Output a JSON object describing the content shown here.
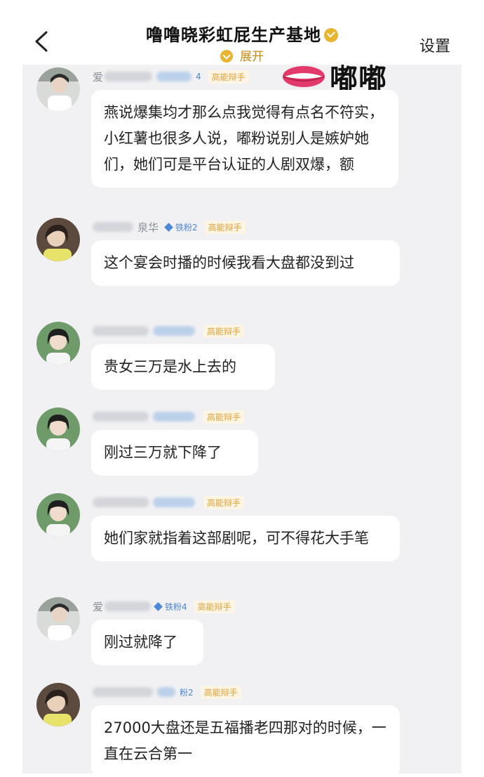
{
  "header": {
    "title": "噜噜晓彩虹屁生产基地",
    "expand_label": "展开",
    "settings_label": "设置"
  },
  "overlay": {
    "text": "嘟嘟"
  },
  "messages": [
    {
      "name": "爱",
      "badge_fan": "4",
      "badge_title": "高能辩手",
      "text": "燕说爆集均才那么点我觉得有点名不符实，小红薯也很多人说，嘟粉说别人是嫉妒她们，她们可是平台认证的人剧双爆，额"
    },
    {
      "name": "泉华",
      "badge_fan": "铁粉2",
      "badge_title": "高能辩手",
      "text": "这个宴会时播的时候我看大盘都没到过"
    },
    {
      "name": "",
      "badge_fan": "",
      "badge_title": "高能辩手",
      "text": "贵女三万是水上去的"
    },
    {
      "name": "",
      "badge_fan": "",
      "badge_title": "高能辩手",
      "text": "刚过三万就下降了"
    },
    {
      "name": "",
      "badge_fan": "",
      "badge_title": "高能辩手",
      "text": "她们家就指着这部剧呢，可不得花大手笔"
    },
    {
      "name": "爱",
      "badge_fan": "铁粉4",
      "badge_title": "高能辩手",
      "text": "刚过就降了"
    },
    {
      "name": "",
      "badge_fan": "粉2",
      "badge_title": "高能辩手",
      "text": "27000大盘还是五福播老四那对的时候，一直在云合第一"
    }
  ]
}
